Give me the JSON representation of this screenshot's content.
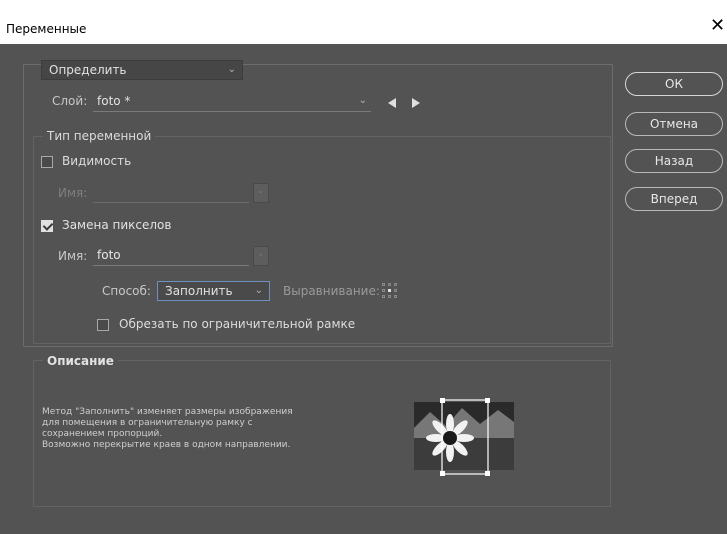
{
  "window": {
    "title": "Переменные",
    "close_glyph": "✕"
  },
  "define_dropdown": {
    "value": "Определить"
  },
  "layer": {
    "label": "Слой:",
    "value": "foto *"
  },
  "var_type": {
    "legend": "Тип переменной",
    "visibility": {
      "label": "Видимость",
      "checked": false,
      "name_label": "Имя:",
      "name_value": ""
    },
    "pixel_replace": {
      "label": "Замена пикселов",
      "checked": true,
      "name_label": "Имя:",
      "name_value": "foto"
    },
    "method": {
      "label": "Способ:",
      "value": "Заполнить"
    },
    "alignment": {
      "label": "Выравнивание:"
    },
    "clip": {
      "label": "Обрезать по ограничительной рамке",
      "checked": false
    }
  },
  "description": {
    "legend": "Описание",
    "text": "Метод \"Заполнить\" изменяет размеры изображения\nдля помещения в ограничительную рамку с\nсохранением пропорций.\nВозможно перекрытие краев в одном направлении."
  },
  "buttons": {
    "ok": "ОК",
    "cancel": "Отмена",
    "back": "Назад",
    "forward": "Вперед"
  },
  "icons": {
    "prev": "triangle-left-icon",
    "next": "triangle-right-icon",
    "alignment": "alignment-grid-icon",
    "preview": "fill-preview-icon"
  }
}
